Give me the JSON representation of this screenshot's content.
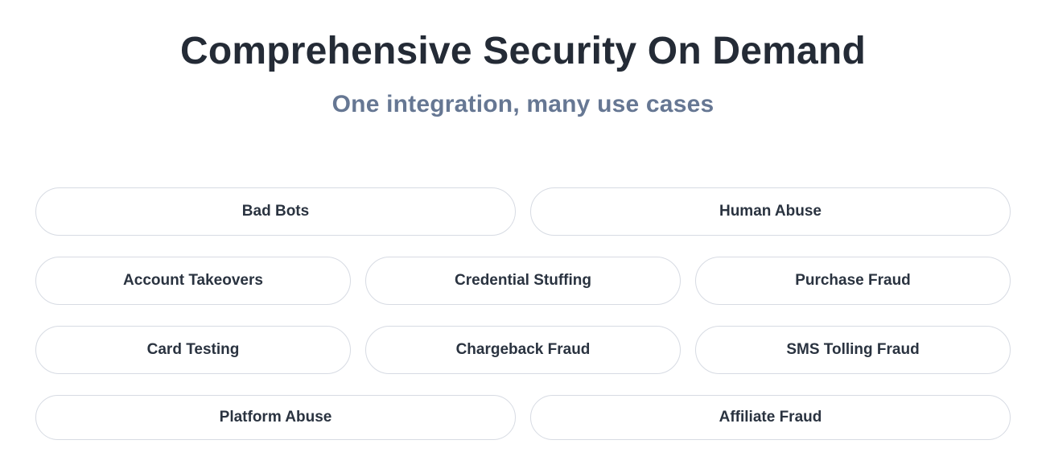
{
  "header": {
    "title": "Comprehensive Security On Demand",
    "subtitle": "One integration, many use cases"
  },
  "pills": {
    "row1": [
      {
        "label": "Bad Bots"
      },
      {
        "label": "Human Abuse"
      }
    ],
    "row2": [
      {
        "label": "Account Takeovers"
      },
      {
        "label": "Credential Stuffing"
      },
      {
        "label": "Purchase Fraud"
      }
    ],
    "row3": [
      {
        "label": "Card Testing"
      },
      {
        "label": "Chargeback Fraud"
      },
      {
        "label": "SMS Tolling Fraud"
      }
    ],
    "row4": [
      {
        "label": "Platform Abuse"
      },
      {
        "label": "Affiliate Fraud"
      }
    ]
  }
}
